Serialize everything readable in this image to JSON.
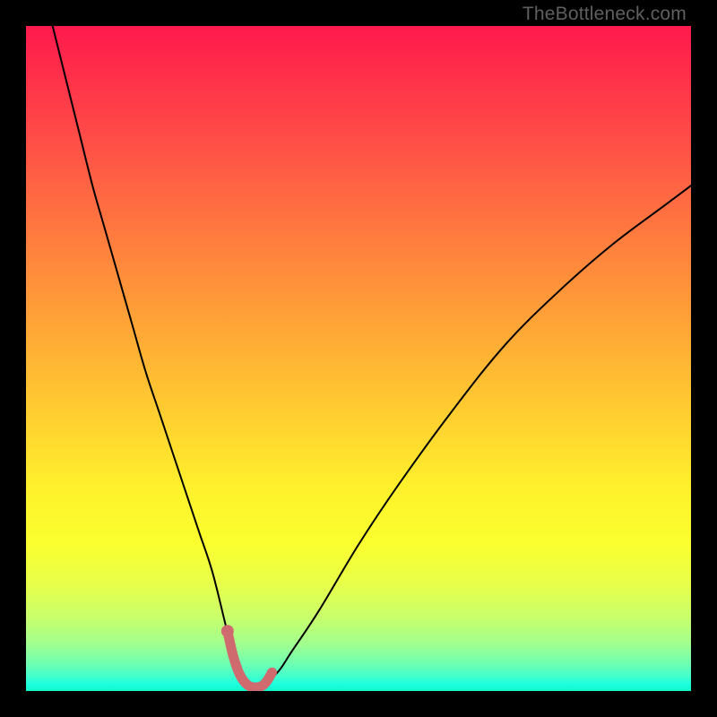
{
  "watermark": "TheBottleneck.com",
  "colors": {
    "curve_stroke": "#000000",
    "highlight_stroke": "#cf6a6f",
    "highlight_dot": "#cf6a6f"
  },
  "chart_data": {
    "type": "line",
    "title": "",
    "xlabel": "",
    "ylabel": "",
    "xlim": [
      0,
      100
    ],
    "ylim": [
      0,
      100
    ],
    "grid": false,
    "legend": false,
    "series": [
      {
        "name": "bottleneck-curve",
        "x": [
          4,
          6,
          8,
          10,
          12,
          14,
          16,
          18,
          20,
          22,
          24,
          26,
          28,
          30,
          31,
          32,
          33,
          34,
          35,
          36,
          38,
          40,
          44,
          50,
          56,
          64,
          72,
          80,
          88,
          96,
          100
        ],
        "y": [
          100,
          92,
          84,
          76,
          69,
          62,
          55,
          48,
          42,
          36,
          30,
          24,
          18,
          10,
          6,
          3,
          1.2,
          0.6,
          0.6,
          1.2,
          3,
          6,
          12,
          22,
          31,
          42,
          52,
          60,
          67,
          73,
          76
        ]
      }
    ],
    "highlight": {
      "name": "optimal-region",
      "x": [
        30.3,
        31.1,
        32.0,
        33.0,
        34.0,
        35.0,
        36.0,
        37.0
      ],
      "y": [
        9.0,
        5.5,
        2.8,
        1.2,
        0.6,
        0.6,
        1.2,
        2.8
      ]
    },
    "highlight_dot": {
      "x": 30.3,
      "y": 9.0
    }
  }
}
